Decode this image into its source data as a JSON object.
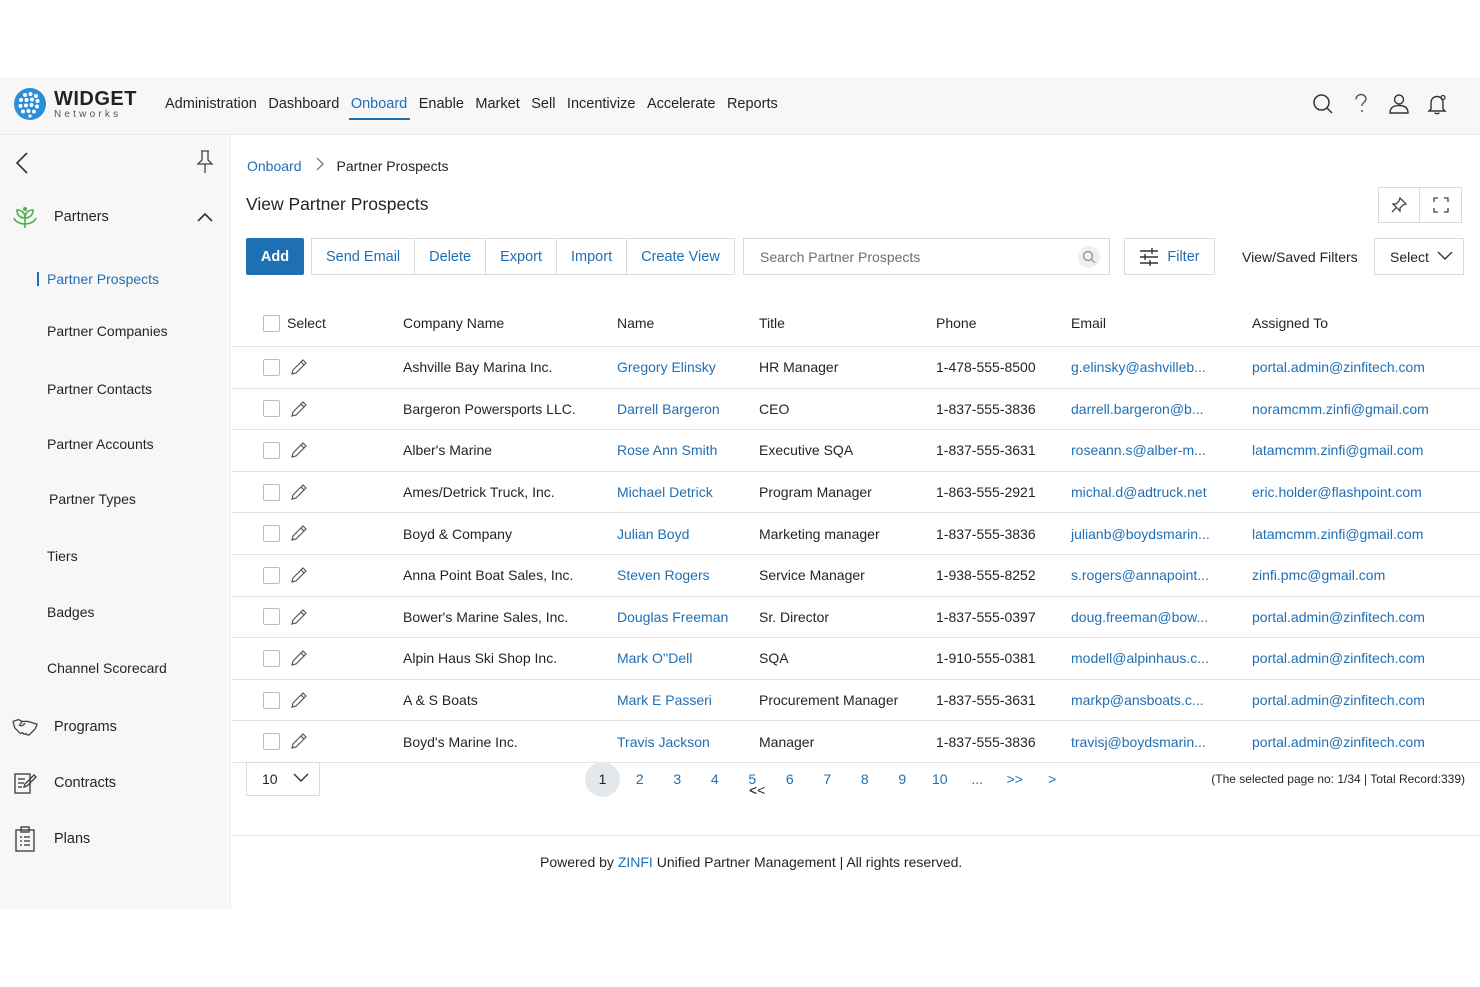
{
  "brand": {
    "title": "WIDGET",
    "subtitle": "Networks"
  },
  "nav": [
    "Administration",
    "Dashboard",
    "Onboard",
    "Enable",
    "Market",
    "Sell",
    "Incentivize",
    "Accelerate",
    "Reports"
  ],
  "nav_active": "Onboard",
  "header_icons": [
    "search-icon",
    "help-icon",
    "user-icon",
    "bell-icon"
  ],
  "sidebar": {
    "partners_label": "Partners",
    "items": [
      "Partner Prospects",
      "Partner Companies",
      "Partner Contacts",
      "Partner Accounts",
      "Partner Types",
      "Tiers",
      "Badges",
      "Channel Scorecard"
    ],
    "active_item": "Partner Prospects",
    "programs_label": "Programs",
    "contracts_label": "Contracts",
    "plans_label": "Plans"
  },
  "breadcrumb": {
    "parent": "Onboard",
    "current": "Partner Prospects"
  },
  "page_title": "View Partner Prospects",
  "toolbar": {
    "add": "Add",
    "buttons": [
      "Send Email",
      "Delete",
      "Export",
      "Import",
      "Create View"
    ],
    "search_placeholder": "Search Partner Prospects",
    "filter": "Filter",
    "saved_filters_label": "View/Saved Filters",
    "saved_filters_value": "Select"
  },
  "table": {
    "headers": [
      "Select",
      "Company Name",
      "Name",
      "Title",
      "Phone",
      "Email",
      "Assigned To"
    ],
    "rows": [
      {
        "company": "Ashville Bay Marina Inc.",
        "name": "Gregory Elinsky",
        "title": "HR Manager",
        "phone": "1-478-555-8500",
        "email": "g.elinsky@ashvilleb...",
        "assigned": "portal.admin@zinfitech.com"
      },
      {
        "company": "Bargeron Powersports LLC.",
        "name": "Darrell Bargeron",
        "title": "CEO",
        "phone": "1-837-555-3836",
        "email": "darrell.bargeron@b...",
        "assigned": "noramcmm.zinfi@gmail.com"
      },
      {
        "company": "Alber's Marine",
        "name": "Rose Ann Smith",
        "title": "Executive SQA",
        "phone": "1-837-555-3631",
        "email": "roseann.s@alber-m...",
        "assigned": "latamcmm.zinfi@gmail.com"
      },
      {
        "company": "Ames/Detrick Truck, Inc.",
        "name": "Michael Detrick",
        "title": "Program Manager",
        "phone": "1-863-555-2921",
        "email": "michal.d@adtruck.net",
        "assigned": "eric.holder@flashpoint.com"
      },
      {
        "company": "Boyd & Company",
        "name": "Julian Boyd",
        "title": "Marketing manager",
        "phone": "1-837-555-3836",
        "email": "julianb@boydsmarin...",
        "assigned": "latamcmm.zinfi@gmail.com"
      },
      {
        "company": "Anna Point Boat Sales, Inc.",
        "name": "Steven Rogers",
        "title": "Service Manager",
        "phone": "1-938-555-8252",
        "email": "s.rogers@annapoint...",
        "assigned": "zinfi.pmc@gmail.com"
      },
      {
        "company": "Bower's Marine Sales, Inc.",
        "name": "Douglas Freeman",
        "title": "Sr. Director",
        "phone": "1-837-555-0397",
        "email": "doug.freeman@bow...",
        "assigned": "portal.admin@zinfitech.com"
      },
      {
        "company": "Alpin Haus Ski Shop Inc.",
        "name": "Mark O''Dell",
        "title": "SQA",
        "phone": "1-910-555-0381",
        "email": "modell@alpinhaus.c...",
        "assigned": "portal.admin@zinfitech.com"
      },
      {
        "company": "A & S Boats",
        "name": "Mark E Passeri",
        "title": "Procurement Manager",
        "phone": "1-837-555-3631",
        "email": "markp@ansboats.c...",
        "assigned": "portal.admin@zinfitech.com"
      },
      {
        "company": "Boyd's Marine Inc.",
        "name": "Travis Jackson",
        "title": "Manager",
        "phone": "1-837-555-3836",
        "email": "travisj@boydsmarin...",
        "assigned": "portal.admin@zinfitech.com"
      }
    ]
  },
  "pagination": {
    "per_page": "10",
    "prev": "<",
    "first": "<<",
    "pages": [
      "1",
      "2",
      "3",
      "4",
      "5",
      "6",
      "7",
      "8",
      "9",
      "10",
      "..."
    ],
    "current": "1",
    "last": ">>",
    "next": ">",
    "info": "(The selected page no: 1/34 | Total Record:339)"
  },
  "footer": {
    "prefix": "Powered by ",
    "brand": "ZINFI",
    "suffix": " Unified Partner Management | All rights reserved."
  },
  "colors": {
    "accent": "#1f6fb5",
    "logo": "#2a8fd8",
    "sidebar_bg": "#f7f7f8",
    "partners_icon": "#4caf50"
  }
}
